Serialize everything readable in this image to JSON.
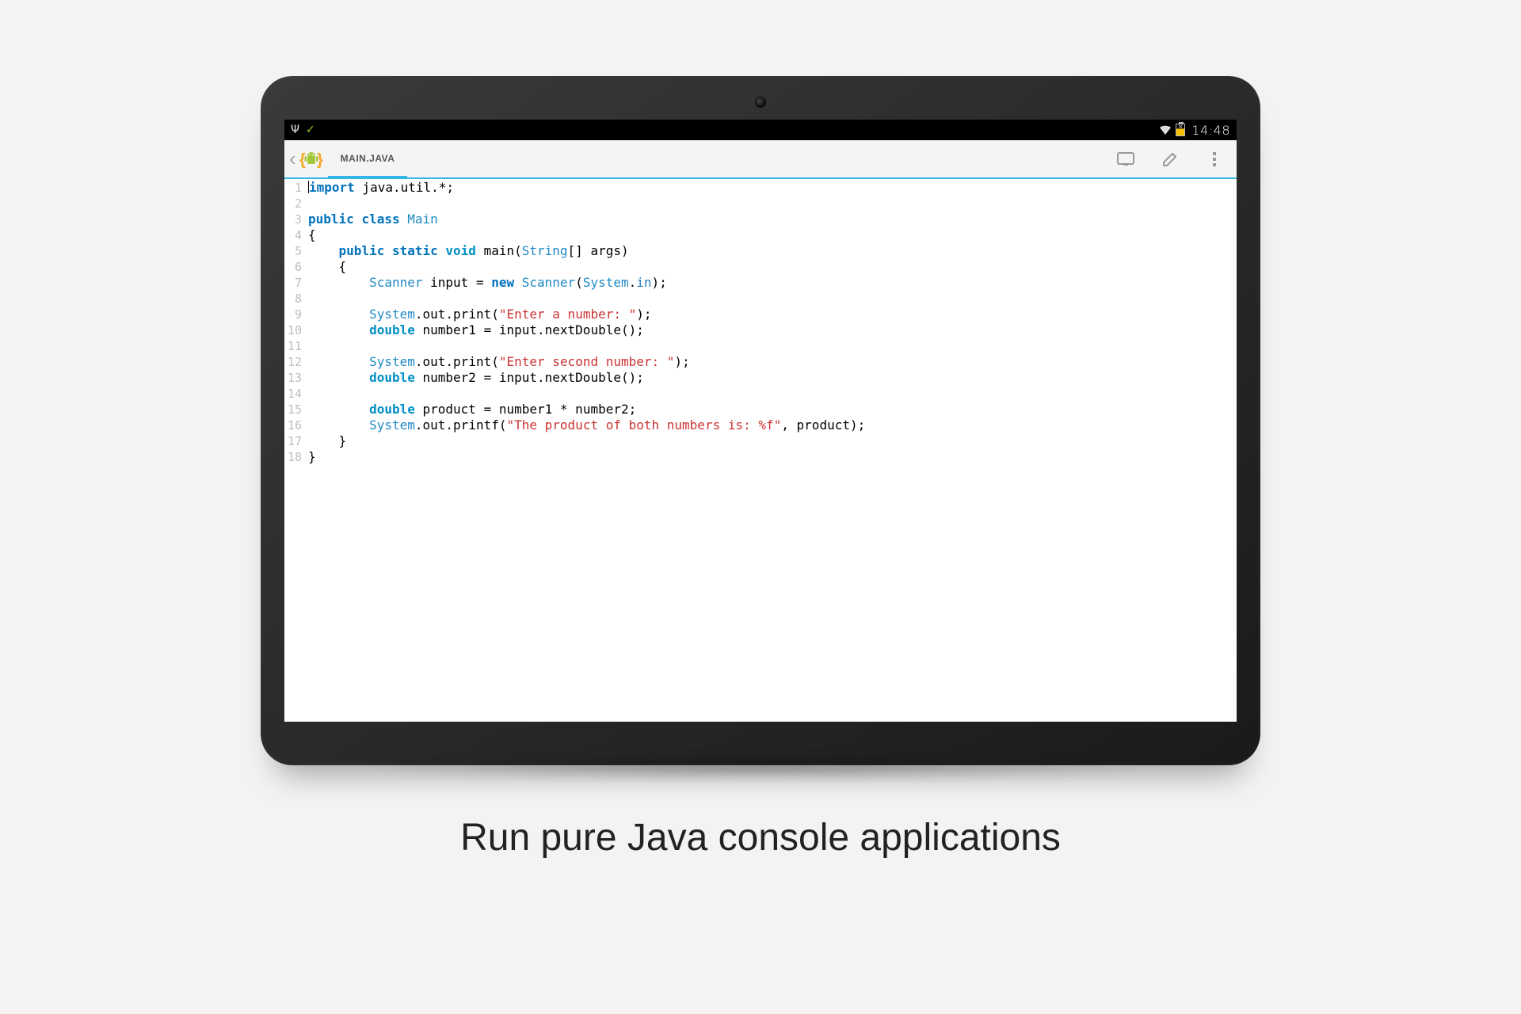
{
  "status": {
    "clock": "14:48"
  },
  "actionbar": {
    "tab_label": "MAIN.JAVA"
  },
  "code": {
    "lines": [
      {
        "n": "1",
        "tokens": [
          {
            "t": "cursor"
          },
          {
            "c": "kw",
            "v": "import"
          },
          {
            "v": " java"
          },
          {
            "c": "pun",
            "v": "."
          },
          {
            "v": "util"
          },
          {
            "c": "pun",
            "v": "."
          },
          {
            "c": "pun",
            "v": "*"
          },
          {
            "c": "pun",
            "v": ";"
          }
        ]
      },
      {
        "n": "2",
        "tokens": []
      },
      {
        "n": "3",
        "tokens": [
          {
            "c": "kw",
            "v": "public"
          },
          {
            "v": " "
          },
          {
            "c": "kw",
            "v": "class"
          },
          {
            "v": " "
          },
          {
            "c": "cls",
            "v": "Main"
          }
        ]
      },
      {
        "n": "4",
        "tokens": [
          {
            "c": "pun",
            "v": "{"
          }
        ]
      },
      {
        "n": "5",
        "tokens": [
          {
            "v": "    "
          },
          {
            "c": "kw",
            "v": "public"
          },
          {
            "v": " "
          },
          {
            "c": "kw",
            "v": "static"
          },
          {
            "v": " "
          },
          {
            "c": "kw2",
            "v": "void"
          },
          {
            "v": " "
          },
          {
            "c": "fn",
            "v": "main"
          },
          {
            "c": "pun",
            "v": "("
          },
          {
            "c": "type",
            "v": "String"
          },
          {
            "c": "pun",
            "v": "[]"
          },
          {
            "v": " args"
          },
          {
            "c": "pun",
            "v": ")"
          }
        ]
      },
      {
        "n": "6",
        "tokens": [
          {
            "v": "    "
          },
          {
            "c": "pun",
            "v": "{"
          }
        ]
      },
      {
        "n": "7",
        "tokens": [
          {
            "v": "        "
          },
          {
            "c": "type",
            "v": "Scanner"
          },
          {
            "v": " input "
          },
          {
            "c": "pun",
            "v": "="
          },
          {
            "v": " "
          },
          {
            "c": "new",
            "v": "new"
          },
          {
            "v": " "
          },
          {
            "c": "type",
            "v": "Scanner"
          },
          {
            "c": "pun",
            "v": "("
          },
          {
            "c": "type",
            "v": "System"
          },
          {
            "c": "pun",
            "v": "."
          },
          {
            "c": "ident",
            "v": "in"
          },
          {
            "c": "pun",
            "v": ")"
          },
          {
            "c": "pun",
            "v": ";"
          }
        ]
      },
      {
        "n": "8",
        "tokens": []
      },
      {
        "n": "9",
        "tokens": [
          {
            "v": "        "
          },
          {
            "c": "type",
            "v": "System"
          },
          {
            "c": "pun",
            "v": "."
          },
          {
            "v": "out"
          },
          {
            "c": "pun",
            "v": "."
          },
          {
            "v": "print"
          },
          {
            "c": "pun",
            "v": "("
          },
          {
            "c": "str",
            "v": "\"Enter a number: \""
          },
          {
            "c": "pun",
            "v": ")"
          },
          {
            "c": "pun",
            "v": ";"
          }
        ]
      },
      {
        "n": "10",
        "tokens": [
          {
            "v": "        "
          },
          {
            "c": "kw2",
            "v": "double"
          },
          {
            "v": " number1 "
          },
          {
            "c": "pun",
            "v": "="
          },
          {
            "v": " input"
          },
          {
            "c": "pun",
            "v": "."
          },
          {
            "v": "nextDouble"
          },
          {
            "c": "pun",
            "v": "("
          },
          {
            "c": "pun",
            "v": ")"
          },
          {
            "c": "pun",
            "v": ";"
          }
        ]
      },
      {
        "n": "11",
        "tokens": []
      },
      {
        "n": "12",
        "tokens": [
          {
            "v": "        "
          },
          {
            "c": "type",
            "v": "System"
          },
          {
            "c": "pun",
            "v": "."
          },
          {
            "v": "out"
          },
          {
            "c": "pun",
            "v": "."
          },
          {
            "v": "print"
          },
          {
            "c": "pun",
            "v": "("
          },
          {
            "c": "str",
            "v": "\"Enter second number: \""
          },
          {
            "c": "pun",
            "v": ")"
          },
          {
            "c": "pun",
            "v": ";"
          }
        ]
      },
      {
        "n": "13",
        "tokens": [
          {
            "v": "        "
          },
          {
            "c": "kw2",
            "v": "double"
          },
          {
            "v": " number2 "
          },
          {
            "c": "pun",
            "v": "="
          },
          {
            "v": " input"
          },
          {
            "c": "pun",
            "v": "."
          },
          {
            "v": "nextDouble"
          },
          {
            "c": "pun",
            "v": "("
          },
          {
            "c": "pun",
            "v": ")"
          },
          {
            "c": "pun",
            "v": ";"
          }
        ]
      },
      {
        "n": "14",
        "tokens": []
      },
      {
        "n": "15",
        "tokens": [
          {
            "v": "        "
          },
          {
            "c": "kw2",
            "v": "double"
          },
          {
            "v": " product "
          },
          {
            "c": "pun",
            "v": "="
          },
          {
            "v": " number1 "
          },
          {
            "c": "pun",
            "v": "*"
          },
          {
            "v": " number2"
          },
          {
            "c": "pun",
            "v": ";"
          }
        ]
      },
      {
        "n": "16",
        "tokens": [
          {
            "v": "        "
          },
          {
            "c": "type",
            "v": "System"
          },
          {
            "c": "pun",
            "v": "."
          },
          {
            "v": "out"
          },
          {
            "c": "pun",
            "v": "."
          },
          {
            "v": "printf"
          },
          {
            "c": "pun",
            "v": "("
          },
          {
            "c": "str",
            "v": "\"The product of both numbers is: %f\""
          },
          {
            "c": "pun",
            "v": ","
          },
          {
            "v": " product"
          },
          {
            "c": "pun",
            "v": ")"
          },
          {
            "c": "pun",
            "v": ";"
          }
        ]
      },
      {
        "n": "17",
        "tokens": [
          {
            "v": "    "
          },
          {
            "c": "pun",
            "v": "}"
          }
        ]
      },
      {
        "n": "18",
        "tokens": [
          {
            "c": "pun",
            "v": "}"
          }
        ]
      }
    ]
  },
  "caption": "Run pure Java console applications"
}
